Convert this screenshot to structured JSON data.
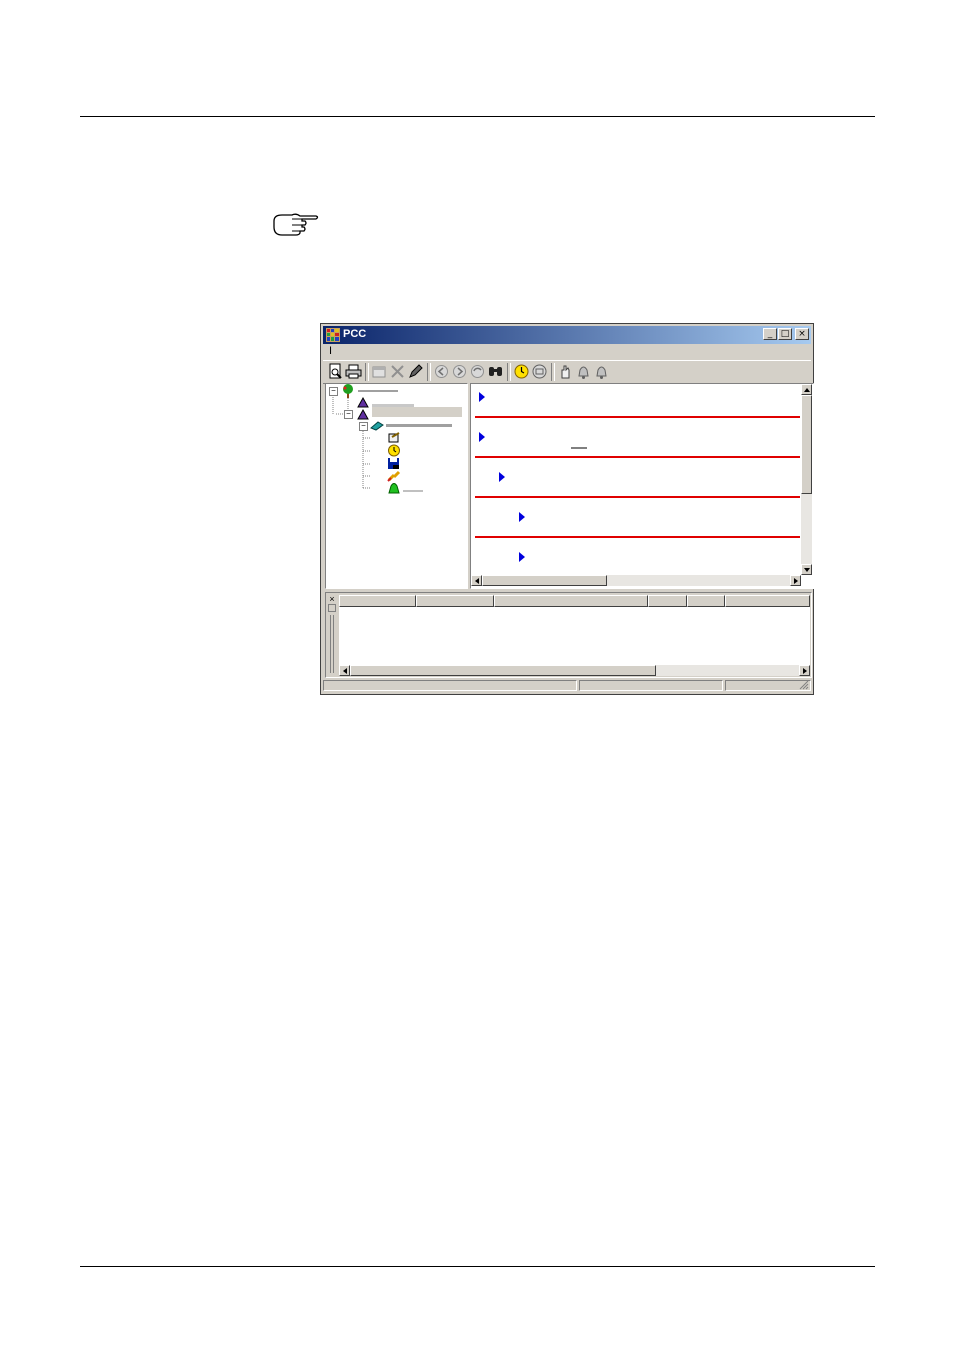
{
  "window": {
    "title": "PCC",
    "menu_label": "I",
    "controls": {
      "minimize": "_",
      "maximize": "□",
      "close": "×"
    },
    "colors": {
      "titlebar_start": "#0a246a",
      "titlebar_end": "#a6caf0",
      "divider": "#e00000",
      "bullet": "#0000dd"
    }
  },
  "toolbar": {
    "icons": [
      "print-preview-icon",
      "print-icon",
      "properties-icon",
      "delete-icon",
      "edit-icon",
      "back-icon",
      "forward-icon",
      "refresh-icon",
      "binoculars-icon",
      "clock-icon",
      "connect-icon",
      "hand-icon",
      "alarm-bell-icon",
      "bell-icon"
    ]
  },
  "tree": {
    "icons": [
      "tree-root-icon",
      "device-icon",
      "device-icon",
      "controller-icon",
      "schedule-icon",
      "clock-icon",
      "save-icon",
      "link-icon",
      "alarm-icon"
    ]
  },
  "content": {
    "bullets": 5
  },
  "output": {
    "close_glyph": "×",
    "columns": 7
  },
  "page": {
    "note_icon": "pointing-hand-icon"
  }
}
